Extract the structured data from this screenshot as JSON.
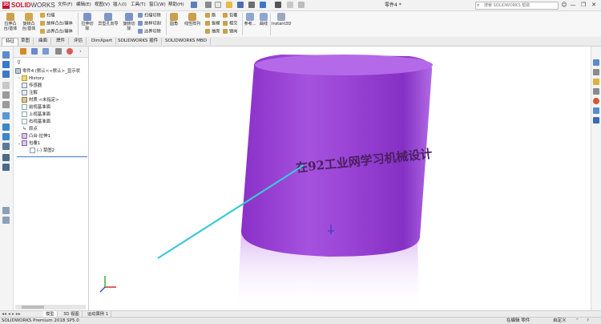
{
  "app": {
    "brand_ds": "3S",
    "brand_solid": "SOLID",
    "brand_works": "WORKS",
    "document_title": "零件4 *"
  },
  "menu": [
    "文件(F)",
    "编辑(E)",
    "视图(V)",
    "插入(I)",
    "工具(T)",
    "窗口(W)",
    "帮助(H)"
  ],
  "search": {
    "placeholder": "搜索 SOLIDWORKS 帮助"
  },
  "ribbon": {
    "extrude_boss": "拉伸凸台/基体",
    "revolve_boss": "旋转凸台/基体",
    "sweep": "扫描",
    "loft_boss": "放样凸台/基体",
    "boundary_boss": "边界凸台/基体",
    "extrude_cut": "拉伸切除",
    "hole_wizard": "异型孔向导",
    "revolve_cut": "旋转切除",
    "sweep_cut": "扫描切除",
    "loft_cut": "放样切割",
    "boundary_cut": "边界切除",
    "fillet": "圆角",
    "linear_pattern": "线性阵列",
    "rib": "筋",
    "draft": "拔模",
    "shell": "抽壳",
    "wrap": "包覆",
    "intersect": "相交",
    "mirror": "镜向",
    "reference": "参考...",
    "curves": "曲线",
    "instant3d": "Instant3D"
  },
  "command_tabs": [
    "特征",
    "草图",
    "曲面",
    "焊件",
    "评估",
    "DimXpert",
    "SOLIDWORKS 插件",
    "SOLIDWORKS MBD"
  ],
  "tree": {
    "root": "零件4 (默认<<默认>_显示状",
    "history": "History",
    "sensors": "传感器",
    "annotations": "注解",
    "material": "材质 <未指定>",
    "front_plane": "前视基准面",
    "top_plane": "上视基准面",
    "right_plane": "右视基准面",
    "origin": "原点",
    "extrude1": "凸台-拉伸1",
    "wrap1": "包覆1",
    "sketch2": "(-) 草图2"
  },
  "viewport": {
    "wrap_text": "在92工业网学习机械设计",
    "cylinder_color": "#9b45d6",
    "cylinder_top": "#b46ae8",
    "leader_color": "#3cc8d8"
  },
  "bottom_tabs": [
    "模型",
    "3D 视图",
    "运动算例 1"
  ],
  "status": {
    "version": "SOLIDWORKS Premium 2018 SP5.0",
    "editing": "在编辑 零件",
    "custom": "自定义"
  }
}
